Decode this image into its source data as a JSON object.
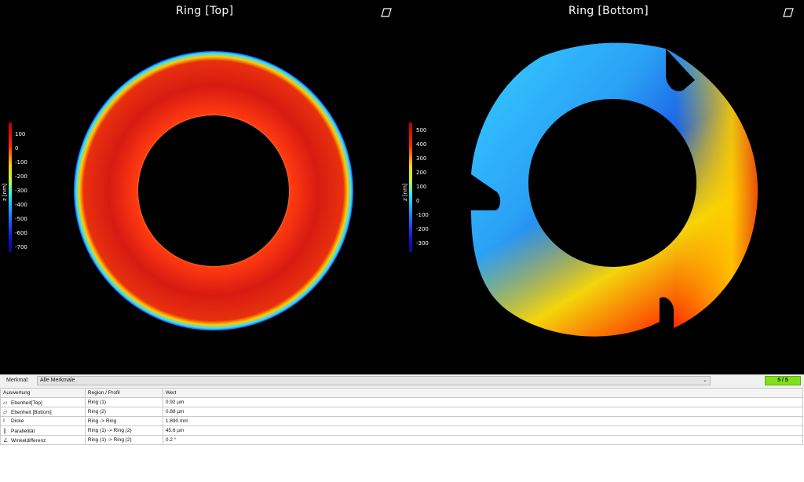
{
  "views": [
    {
      "title": "Ring [Top]",
      "colorbar": {
        "ticks": [
          "100",
          "0",
          "-100",
          "-200",
          "-300",
          "-400",
          "-500",
          "-600",
          "-700"
        ],
        "unit": "z [nm]"
      }
    },
    {
      "title": "Ring [Bottom]",
      "colorbar": {
        "ticks": [
          "500",
          "400",
          "300",
          "200",
          "100",
          "0",
          "-100",
          "-200",
          "-300"
        ],
        "unit": "z [nm]"
      }
    }
  ],
  "merkmal": {
    "label": "Merkmal:",
    "value": "Alle Merkmale",
    "count": "5 / 5"
  },
  "table": {
    "headers": [
      "Auswertung",
      "Region / Profil",
      "Wert"
    ],
    "rows": [
      {
        "icon": "flatness-icon",
        "name": "Ebenheit[Top]",
        "region": "Ring (1)",
        "value": "0.92 µm"
      },
      {
        "icon": "flatness-icon",
        "name": "Ebenheit [Bottom]",
        "region": "Ring (2)",
        "value": "0.88 µm"
      },
      {
        "icon": "thickness-icon",
        "name": "Dicke",
        "region": "Ring -> Ring",
        "value": "1.890 mm"
      },
      {
        "icon": "parallelism-icon",
        "name": "Parallelität",
        "region": "Ring (1) -> Ring (2)",
        "value": "45.6 µm"
      },
      {
        "icon": "angle-icon",
        "name": "Winkeldifferenz",
        "region": "Ring (1) -> Ring (2)",
        "value": "0.2 °"
      }
    ]
  },
  "colors": {
    "badge": "#7fe01b",
    "viewport_bg": "#000000"
  }
}
